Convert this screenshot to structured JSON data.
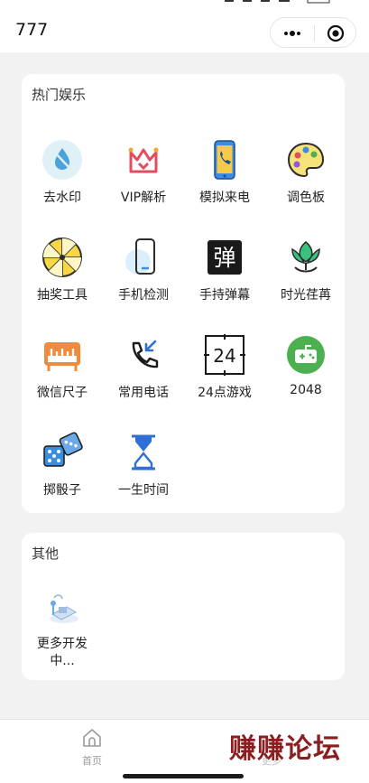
{
  "header": {
    "title": "777",
    "more_icon": "more-dots-icon",
    "close_icon": "target-circle-icon"
  },
  "sections": {
    "hot": {
      "title": "热门娱乐",
      "items": [
        {
          "label": "去水印",
          "icon": "watermark-drop-icon"
        },
        {
          "label": "VIP解析",
          "icon": "vip-crown-icon"
        },
        {
          "label": "模拟来电",
          "icon": "incoming-call-phone-icon"
        },
        {
          "label": "调色板",
          "icon": "palette-icon"
        },
        {
          "label": "抽奖工具",
          "icon": "lottery-wheel-icon"
        },
        {
          "label": "手机检测",
          "icon": "phone-check-icon"
        },
        {
          "label": "手持弹幕",
          "icon": "barrage-icon"
        },
        {
          "label": "时光荏苒",
          "icon": "lotus-clock-icon"
        },
        {
          "label": "微信尺子",
          "icon": "ruler-icon"
        },
        {
          "label": "常用电话",
          "icon": "phone-call-icon"
        },
        {
          "label": "24点游戏",
          "icon": "card-24-icon"
        },
        {
          "label": "2048",
          "icon": "gamepad-icon"
        },
        {
          "label": "掷骰子",
          "icon": "dice-icon"
        },
        {
          "label": "一生时间",
          "icon": "hourglass-icon"
        }
      ],
      "barrage_char": "弹",
      "card_24_text": "24"
    },
    "other": {
      "title": "其他",
      "items": [
        {
          "label": "更多开发中...",
          "label_line1": "更多开发",
          "label_line2": "中...",
          "icon": "developing-icon"
        }
      ]
    }
  },
  "tabbar": {
    "home_label": "首页",
    "more_label": "更多"
  },
  "watermark_text": "赚赚论坛",
  "colors": {
    "background": "#f2f2f2",
    "card": "#ffffff",
    "accent_blue": "#2f6fd6",
    "vip_red": "#e54a5f",
    "ruler_orange": "#f08a3c",
    "game_green": "#4caf50",
    "lotus_green": "#3ac17d"
  }
}
